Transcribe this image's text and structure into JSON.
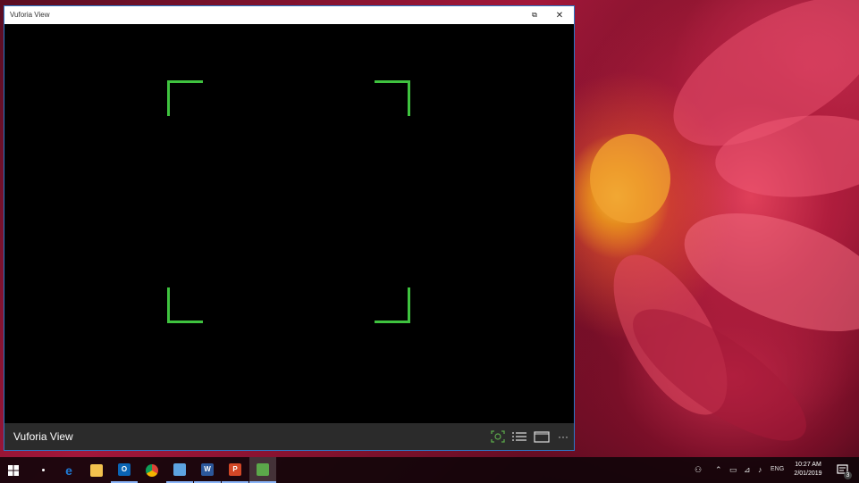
{
  "window": {
    "title": "Vuforia View",
    "maximize_glyph": "⧉",
    "close_glyph": "✕",
    "frame_color": "#2b78c8"
  },
  "viewport": {
    "target_frame_color": "#3fc33f",
    "background": "#000000"
  },
  "app_bar": {
    "app_name": "Vuforia View",
    "icons": [
      "scan-icon",
      "list-icon",
      "view-icon",
      "more-icon"
    ],
    "more_glyph": "···"
  },
  "taskbar": {
    "start_icon": "windows-logo-icon",
    "pinned": [
      {
        "name": "edge",
        "glyph": "e",
        "color": "#1e7bd6"
      },
      {
        "name": "file-explorer",
        "glyph": "",
        "color": "#f2c14e"
      },
      {
        "name": "outlook",
        "glyph": "O",
        "color": "#0a64b4"
      },
      {
        "name": "chrome",
        "glyph": "",
        "color": "#2e9b4f"
      },
      {
        "name": "remote",
        "glyph": "",
        "color": "#5da3e0"
      },
      {
        "name": "word",
        "glyph": "W",
        "color": "#2b579a"
      },
      {
        "name": "powerpoint",
        "glyph": "P",
        "color": "#d24726"
      },
      {
        "name": "vuforia-view",
        "glyph": "",
        "color": "#5ba84a"
      }
    ],
    "tray": {
      "language": "ENG",
      "time": "10:27 AM",
      "date": "2/01/2019",
      "notification_count": "3"
    }
  }
}
